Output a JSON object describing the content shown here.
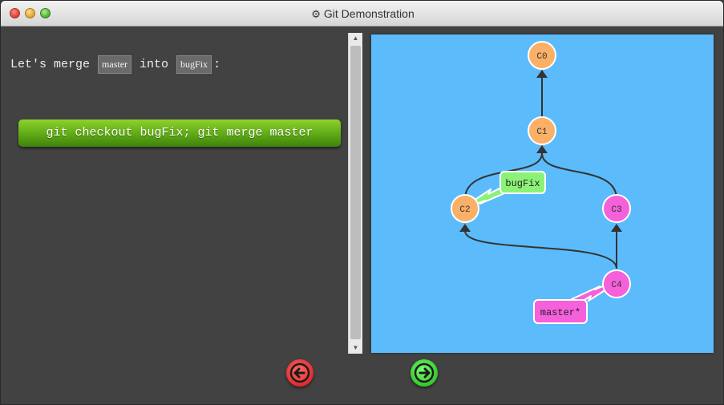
{
  "window": {
    "title": "Git Demonstration",
    "title_icon": "gear-icon"
  },
  "instruction": {
    "prefix": "Let's merge",
    "source_branch": "master",
    "middle": "into",
    "target_branch": "bugFix",
    "suffix": ":"
  },
  "command_button": {
    "label": "git checkout bugFix; git merge master",
    "color": "#5da915"
  },
  "graph": {
    "background": "#5cbbfb",
    "commits": [
      {
        "id": "C0",
        "color": "#fbb068"
      },
      {
        "id": "C1",
        "color": "#fbb068"
      },
      {
        "id": "C2",
        "color": "#fbb068"
      },
      {
        "id": "C3",
        "color": "#f560db"
      },
      {
        "id": "C4",
        "color": "#f560db"
      }
    ],
    "branches": [
      {
        "name": "bugFix",
        "target": "C2",
        "color": "#8cf277"
      },
      {
        "name": "master*",
        "target": "C4",
        "color": "#f560db"
      }
    ]
  },
  "navigation": {
    "back_icon": "arrow-left-icon",
    "back_color": "#e02a2a",
    "forward_icon": "arrow-right-icon",
    "forward_color": "#35c72b"
  }
}
